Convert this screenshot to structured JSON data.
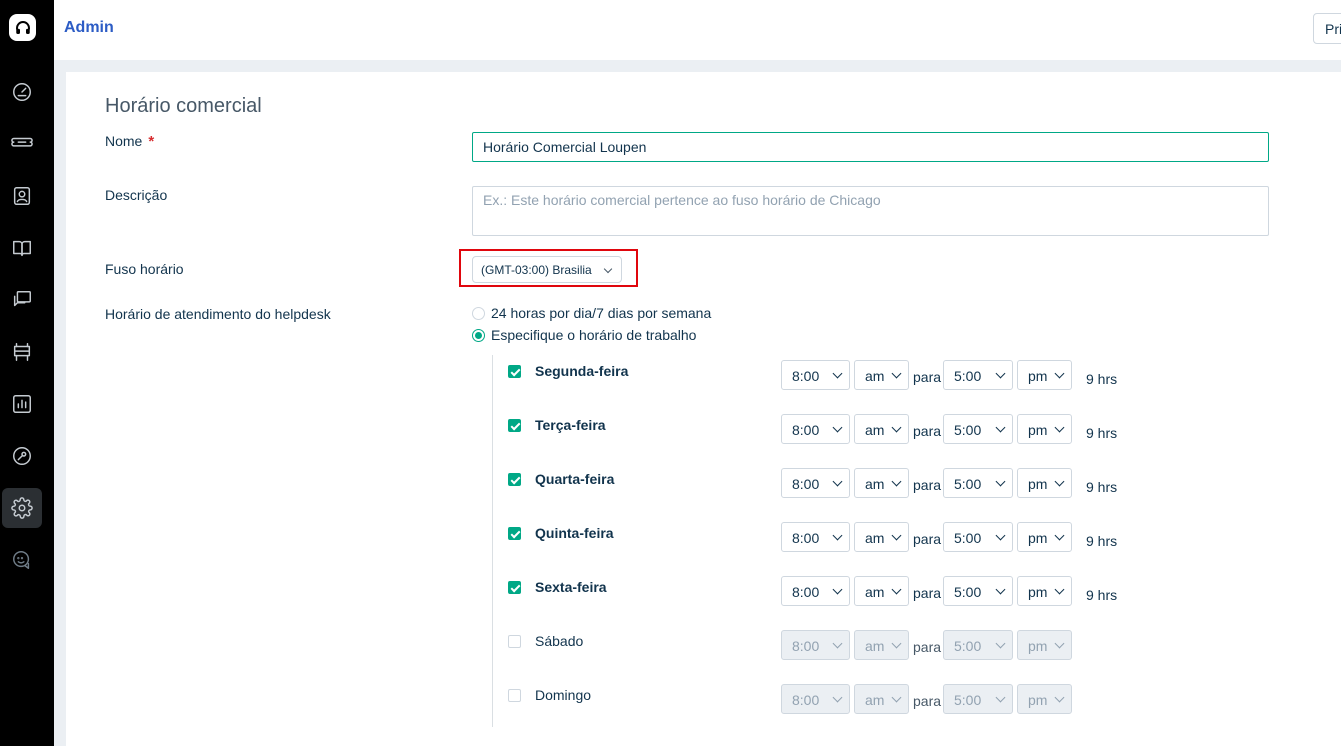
{
  "header": {
    "title": "Admin",
    "right_button": "Pri"
  },
  "sidebar": {
    "items": [
      {
        "name": "dashboard-icon"
      },
      {
        "name": "tickets-icon"
      },
      {
        "name": "contacts-icon"
      },
      {
        "name": "solutions-icon"
      },
      {
        "name": "forums-icon"
      },
      {
        "name": "assets-icon"
      },
      {
        "name": "reports-icon"
      },
      {
        "name": "wrench-icon"
      },
      {
        "name": "gear-icon",
        "active": true
      },
      {
        "name": "chat-icon"
      }
    ]
  },
  "form": {
    "section_title": "Horário comercial",
    "name_label": "Nome",
    "required_mark": "*",
    "name_value": "Horário Comercial Loupen",
    "description_label": "Descrição",
    "description_placeholder": "Ex.: Este horário comercial pertence ao fuso horário de Chicago",
    "timezone_label": "Fuso horário",
    "timezone_value": "(GMT-03:00) Brasilia",
    "helpdesk_hours_label": "Horário de atendimento do helpdesk",
    "option_24x7": "24 horas por dia/7 dias por semana",
    "option_custom": "Especifique o horário de trabalho",
    "selected_option": "custom",
    "to_label": "para",
    "days": [
      {
        "name": "Segunda-feira",
        "checked": true,
        "from_time": "8:00",
        "from_ampm": "am",
        "to_time": "5:00",
        "to_ampm": "pm",
        "hours": "9 hrs"
      },
      {
        "name": "Terça-feira",
        "checked": true,
        "from_time": "8:00",
        "from_ampm": "am",
        "to_time": "5:00",
        "to_ampm": "pm",
        "hours": "9 hrs"
      },
      {
        "name": "Quarta-feira",
        "checked": true,
        "from_time": "8:00",
        "from_ampm": "am",
        "to_time": "5:00",
        "to_ampm": "pm",
        "hours": "9 hrs"
      },
      {
        "name": "Quinta-feira",
        "checked": true,
        "from_time": "8:00",
        "from_ampm": "am",
        "to_time": "5:00",
        "to_ampm": "pm",
        "hours": "9 hrs"
      },
      {
        "name": "Sexta-feira",
        "checked": true,
        "from_time": "8:00",
        "from_ampm": "am",
        "to_time": "5:00",
        "to_ampm": "pm",
        "hours": "9 hrs"
      },
      {
        "name": "Sábado",
        "checked": false,
        "from_time": "8:00",
        "from_ampm": "am",
        "to_time": "5:00",
        "to_ampm": "pm",
        "hours": ""
      },
      {
        "name": "Domingo",
        "checked": false,
        "from_time": "8:00",
        "from_ampm": "am",
        "to_time": "5:00",
        "to_ampm": "pm",
        "hours": ""
      }
    ]
  },
  "colors": {
    "accent": "#00a886",
    "link": "#2c5cc5",
    "highlight": "#e0060d",
    "sidebar": "#000000"
  }
}
